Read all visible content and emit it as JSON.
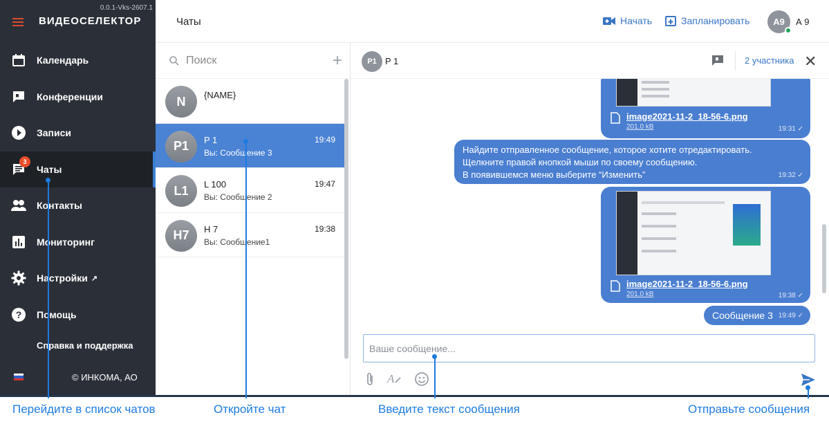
{
  "sidebar": {
    "version": "0.0.1-Vks-2607.1",
    "logo": "ВИДЕОСЕЛЕКТОР",
    "items": [
      {
        "label": "Календарь",
        "icon": "calendar-icon"
      },
      {
        "label": "Конференции",
        "icon": "conference-icon"
      },
      {
        "label": "Записи",
        "icon": "play-icon"
      },
      {
        "label": "Чаты",
        "icon": "chat-icon",
        "badge": "3",
        "active": true
      },
      {
        "label": "Контакты",
        "icon": "contacts-icon"
      },
      {
        "label": "Мониторинг",
        "icon": "chart-icon"
      },
      {
        "label": "Настройки",
        "icon": "gear-icon"
      },
      {
        "label": "Помощь",
        "icon": "help-icon"
      }
    ],
    "support": "Справка и поддержка",
    "copyright": "© ИНКОМА, АО"
  },
  "header": {
    "title": "Чаты",
    "start_label": "Начать",
    "schedule_label": "Запланировать",
    "user_initials": "А9",
    "user_name": "А 9"
  },
  "chat_list": {
    "search_placeholder": "Поиск",
    "chats": [
      {
        "initials": "N",
        "name": "{NAME}",
        "time": "",
        "last": ""
      },
      {
        "initials": "P1",
        "name": "P 1",
        "time": "19:49",
        "last": "Вы: Сообщение 3",
        "selected": true
      },
      {
        "initials": "L1",
        "name": "L 100",
        "time": "19:47",
        "last": "Вы: Сообщение 2"
      },
      {
        "initials": "H7",
        "name": "H 7",
        "time": "19:38",
        "last": "Вы: Сообщение1"
      }
    ]
  },
  "chat": {
    "initials": "P1",
    "name": "P 1",
    "members": "2 участника",
    "messages": [
      {
        "type": "image",
        "file": "image2021-11-2_18-56-6.png",
        "size": "201.0 kB",
        "time": "19:31"
      },
      {
        "type": "text",
        "lines": [
          "Найдите отправленное сообщение, которое хотите отредактировать.",
          "Щелкните правой кнопкой мыши по своему сообщению.",
          "В появившемся меню выберите “Изменить”"
        ],
        "time": "19:32"
      },
      {
        "type": "image",
        "file": "image2021-11-2_18-56-6.png",
        "size": "201.0 kB",
        "time": "19:38"
      },
      {
        "type": "text",
        "lines": [
          "Сообщение 3"
        ],
        "time": "19:49"
      }
    ],
    "composer_placeholder": "Ваше сообщение..."
  },
  "annotations": {
    "a1": "Перейдите в список чатов",
    "a2": "Откройте чат",
    "a3": "Введите текст сообщения",
    "a4": "Отправьте сообщения"
  },
  "colors": {
    "accent": "#4a82d4",
    "sidebar": "#2b3038",
    "annotation": "#1e7be0",
    "badge": "#e94e2a"
  }
}
